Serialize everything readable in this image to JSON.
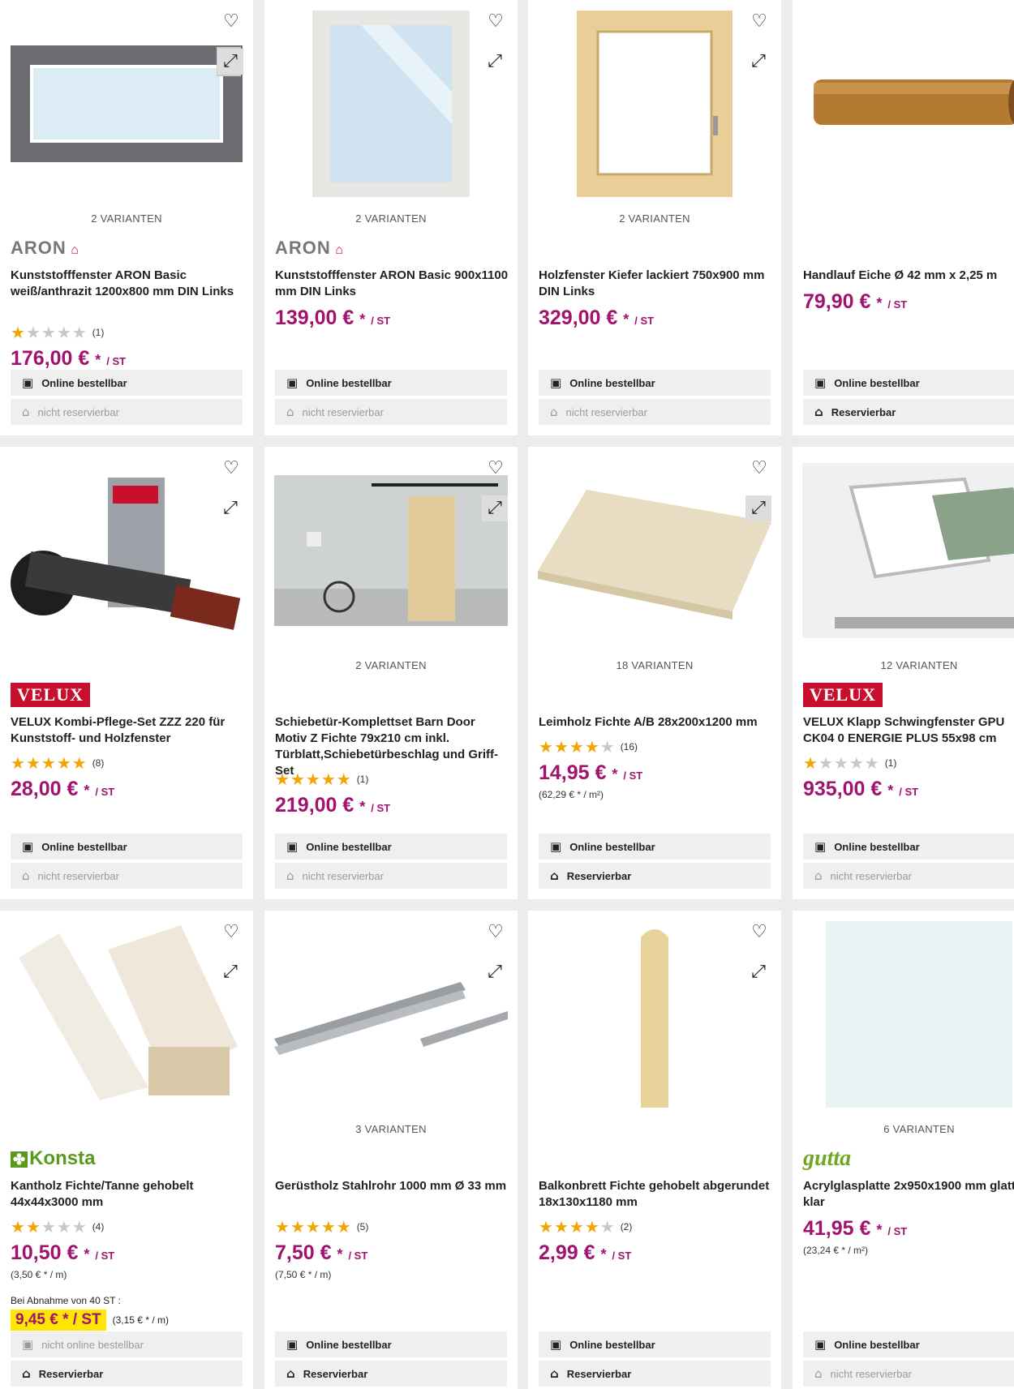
{
  "icons": {
    "favorite": "heart-outline-icon",
    "compare": "compare-arrows-icon",
    "online": "shopping-bag-icon",
    "reserve": "store-icon"
  },
  "colors": {
    "price": "#a0136f",
    "star": "#f2a500",
    "velux": "#c8102e",
    "highlight": "#ffe600"
  },
  "products": [
    {
      "variants": "2 VARIANTEN",
      "brand": "ARON",
      "title": "Kunststofffenster ARON Basic weiß/anthrazit 1200x800 mm DIN Links",
      "rating": 1,
      "reviews": "(1)",
      "price": "176,00 €",
      "unit": "/ ST",
      "online": "Online bestellbar",
      "reserve": "nicht reservierbar"
    },
    {
      "variants": "2 VARIANTEN",
      "brand": "ARON",
      "title": "Kunststofffenster ARON Basic 900x1100 mm DIN Links",
      "price": "139,00 €",
      "unit": "/ ST",
      "online": "Online bestellbar",
      "reserve": "nicht reservierbar"
    },
    {
      "variants": "2 VARIANTEN",
      "title": "Holzfenster Kiefer lackiert 750x900 mm DIN Links",
      "price": "329,00 €",
      "unit": "/ ST",
      "online": "Online bestellbar",
      "reserve": "nicht reservierbar"
    },
    {
      "title": "Handlauf Eiche Ø 42 mm x 2,25 m",
      "price": "79,90 €",
      "unit": "/ ST",
      "online": "Online bestellbar",
      "reserve": "Reservierbar"
    },
    {
      "brand": "VELUX",
      "title": "VELUX Kombi-Pflege-Set ZZZ 220 für Kunststoff- und Holzfenster",
      "rating": 5,
      "reviews": "(8)",
      "price": "28,00 €",
      "unit": "/ ST",
      "online": "Online bestellbar",
      "reserve": "nicht reservierbar"
    },
    {
      "variants": "2 VARIANTEN",
      "title": "Schiebetür-Komplettset Barn Door Motiv Z Fichte 79x210 cm inkl. Türblatt,Schiebetürbeschlag und Griff-Set",
      "rating": 5,
      "reviews": "(1)",
      "price": "219,00 €",
      "unit": "/ ST",
      "online": "Online bestellbar",
      "reserve": "nicht reservierbar"
    },
    {
      "variants": "18 VARIANTEN",
      "title": "Leimholz Fichte A/B 28x200x1200 mm",
      "rating": 3.5,
      "reviews": "(16)",
      "price": "14,95 €",
      "unit": "/ ST",
      "base": "(62,29 € * / m²)",
      "online": "Online bestellbar",
      "reserve": "Reservierbar"
    },
    {
      "variants": "12 VARIANTEN",
      "brand": "VELUX",
      "title": "VELUX Klapp Schwingfenster GPU CK04 0 ENERGIE PLUS 55x98 cm",
      "rating": 1,
      "reviews": "(1)",
      "price": "935,00 €",
      "unit": "/ ST",
      "online": "Online bestellbar",
      "reserve": "nicht reservierbar"
    },
    {
      "brand": "Konsta",
      "title": "Kantholz Fichte/Tanne gehobelt 44x44x3000 mm",
      "rating": 2,
      "reviews": "(4)",
      "price": "10,50 €",
      "unit": "/ ST",
      "base": "(3,50 € * / m)",
      "bulk_label": "Bei Abnahme von 40 ST :",
      "bulk_price": "9,45 € * / ST",
      "bulk_base": "(3,15 € * / m)",
      "online": "nicht online bestellbar",
      "reserve": "Reservierbar"
    },
    {
      "variants": "3 VARIANTEN",
      "title": "Gerüstholz Stahlrohr 1000 mm Ø 33 mm",
      "rating": 4.5,
      "reviews": "(5)",
      "price": "7,50 €",
      "unit": "/ ST",
      "base": "(7,50 € * / m)",
      "online": "Online bestellbar",
      "reserve": "Reservierbar"
    },
    {
      "title": "Balkonbrett Fichte gehobelt abgerundet 18x130x1180 mm",
      "rating": 3.5,
      "reviews": "(2)",
      "price": "2,99 €",
      "unit": "/ ST",
      "online": "Online bestellbar",
      "reserve": "Reservierbar"
    },
    {
      "variants": "6 VARIANTEN",
      "brand": "gutta",
      "title": "Acrylglasplatte 2x950x1900 mm glatt klar",
      "price": "41,95 €",
      "unit": "/ ST",
      "base": "(23,24 € * / m²)",
      "online": "Online bestellbar",
      "reserve": "nicht reservierbar"
    }
  ]
}
